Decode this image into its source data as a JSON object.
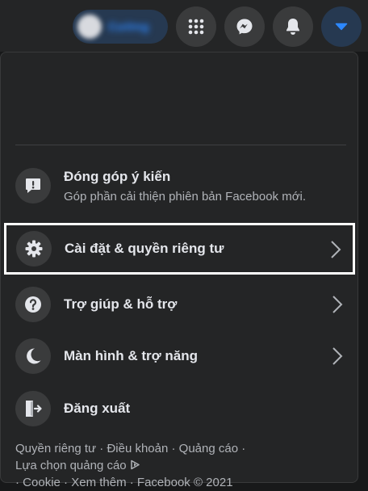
{
  "topbar": {
    "profile_name": "Cường",
    "icons": [
      "menu-grid-icon",
      "messenger-icon",
      "bell-icon",
      "caret-down-icon"
    ]
  },
  "menu": {
    "feedback": {
      "title": "Đóng góp ý kiến",
      "subtitle": "Góp phần cải thiện phiên bản Facebook mới."
    },
    "settings": {
      "title": "Cài đặt & quyền riêng tư"
    },
    "help": {
      "title": "Trợ giúp & hỗ trợ"
    },
    "display": {
      "title": "Màn hình & trợ năng"
    },
    "logout": {
      "title": "Đăng xuất"
    }
  },
  "footer": {
    "privacy": "Quyền riêng tư",
    "terms": "Điều khoản",
    "ads": "Quảng cáo",
    "ad_choices": "Lựa chọn quảng cáo",
    "cookie": "Cookie",
    "more": "Xem thêm",
    "copyright": "Facebook © 2021",
    "separator": " · "
  },
  "colors": {
    "background": "#18191a",
    "surface": "#242526",
    "accent": "#2d88ff",
    "text_primary": "#e4e6eb",
    "text_secondary": "#b0b3b8"
  }
}
